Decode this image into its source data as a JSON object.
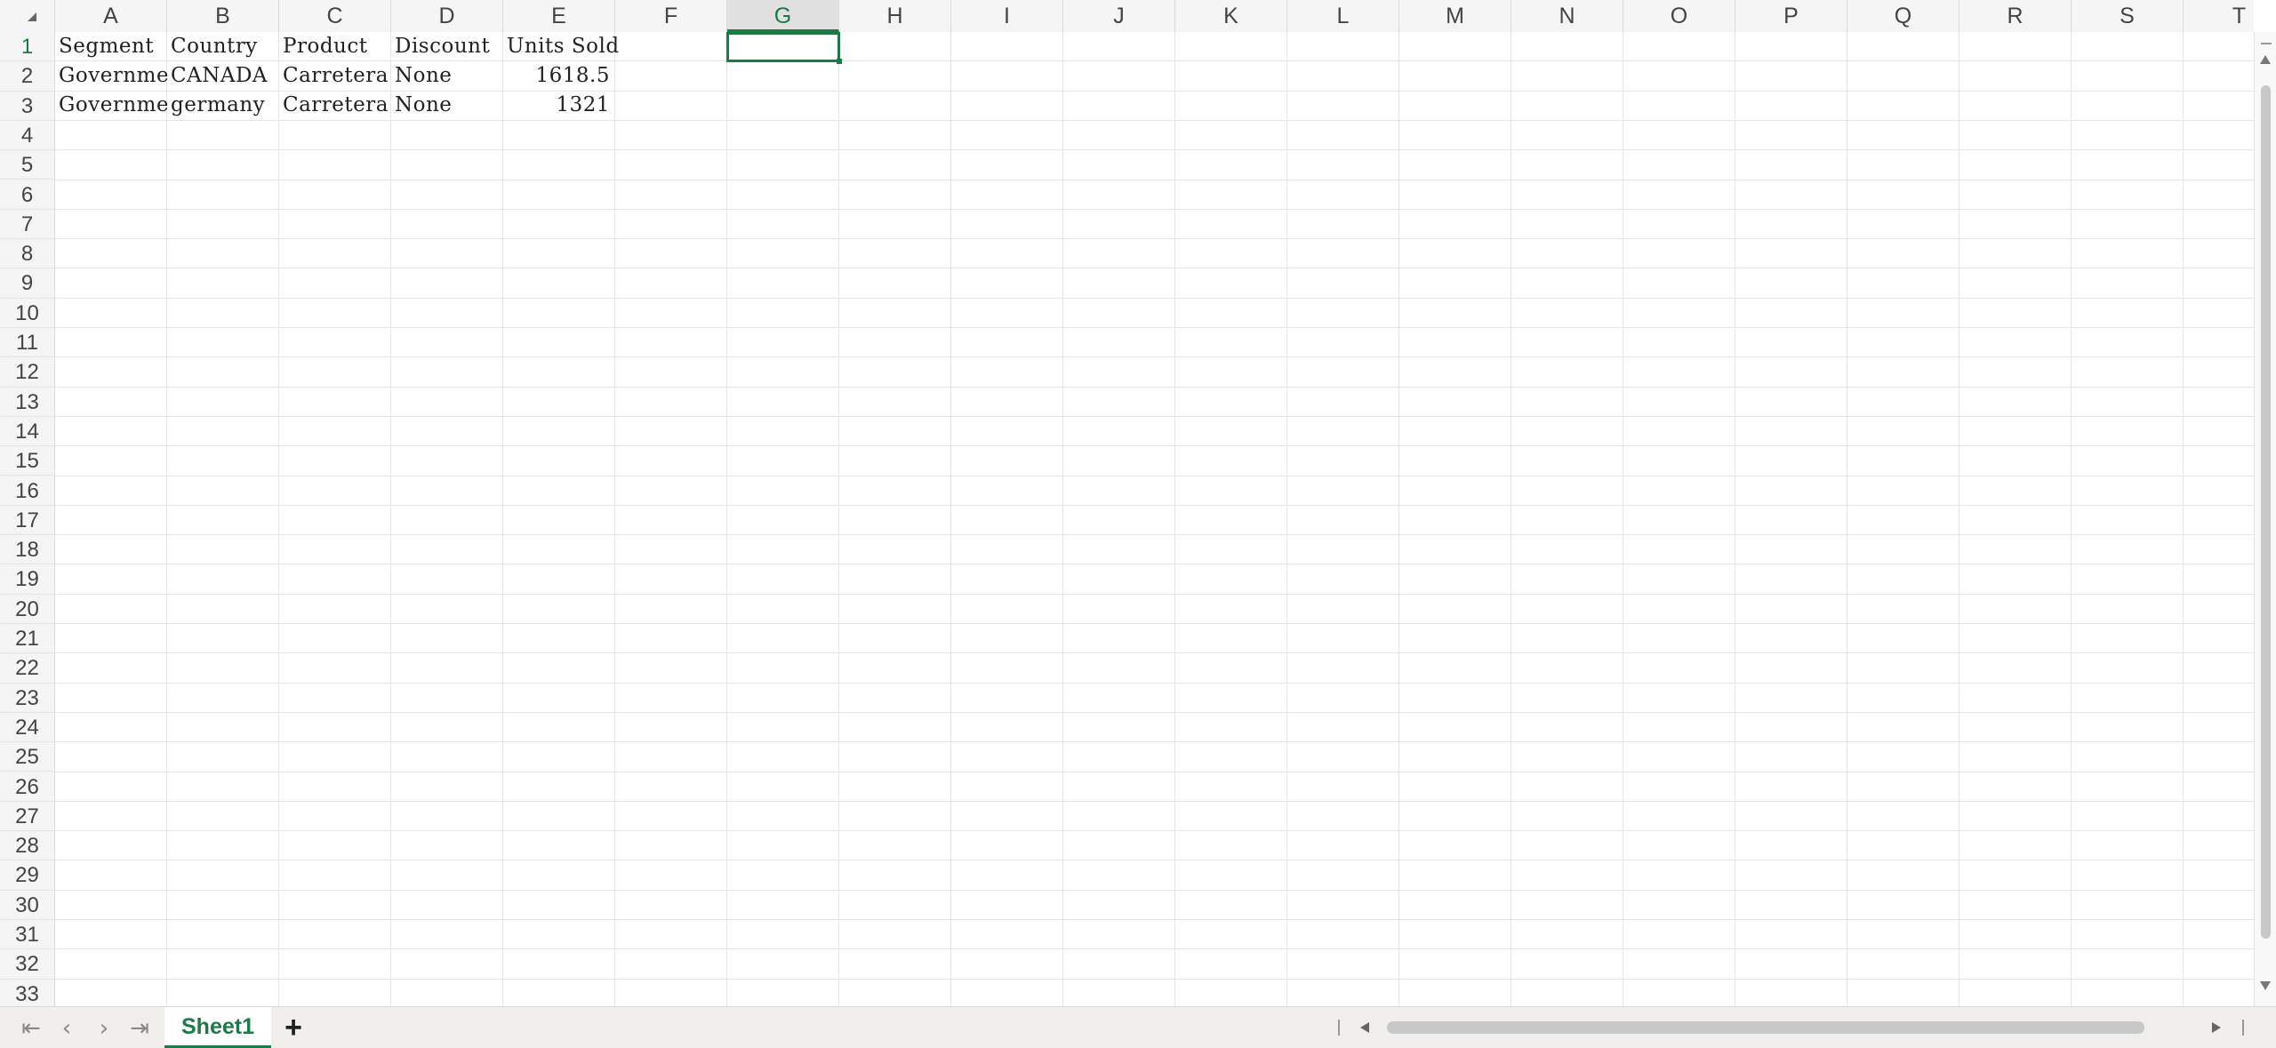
{
  "columns": [
    "A",
    "B",
    "C",
    "D",
    "E",
    "F",
    "G",
    "H",
    "I",
    "J",
    "K",
    "L",
    "M",
    "N",
    "O",
    "P",
    "Q",
    "R",
    "S",
    "T"
  ],
  "selected_column": "G",
  "rows": [
    "1",
    "2",
    "3",
    "4",
    "5",
    "6",
    "7",
    "8",
    "9",
    "10",
    "11",
    "12",
    "13",
    "14",
    "15",
    "16",
    "17",
    "18",
    "19",
    "20",
    "21",
    "22",
    "23",
    "24",
    "25",
    "26",
    "27",
    "28",
    "29",
    "30",
    "31",
    "32",
    "33"
  ],
  "selected_row": "1",
  "cells": {
    "header": [
      "Segment",
      "Country",
      "Product",
      "Discount",
      "Units Sold"
    ],
    "row2": [
      "Governmer",
      "CANADA",
      "Carretera",
      "None",
      "1618.5"
    ],
    "row3": [
      "Governmer",
      "germany",
      "Carretera",
      "None",
      "1321"
    ]
  },
  "sheet_tab": "Sheet1",
  "add_sheet": "+",
  "accent_color": "#1d7a46",
  "icons": {
    "first_sheet": "first-page-icon",
    "prev_sheet": "chevron-left-icon",
    "next_sheet": "chevron-right-icon",
    "last_sheet": "last-page-icon"
  }
}
